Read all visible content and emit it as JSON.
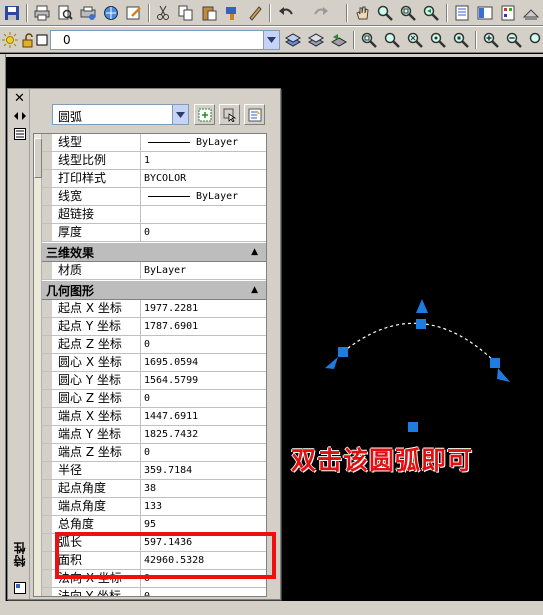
{
  "toolbar_top": {
    "icons": [
      "save-icon",
      "print-icon",
      "print-preview-icon",
      "plot-icon",
      "publish-icon",
      "edit-icon",
      "cut-icon",
      "copy-icon",
      "paste-icon",
      "match-properties-icon",
      "brush-icon",
      "undo-icon",
      "redo-icon",
      "pan-icon",
      "zoom-realtime-icon",
      "zoom-window-icon",
      "zoom-previous-icon",
      "properties-icon",
      "design-center-icon",
      "tool-palette-icon",
      "markup-icon"
    ]
  },
  "toolbar_layer": {
    "layer_name": "0",
    "icons": [
      "layer-on-icon",
      "layer-unlock-icon",
      "layer-color-icon",
      "layer-manager-icon",
      "layer-states-icon",
      "layer-previous-icon",
      "zoom-window2-icon",
      "zoom-dynamic-icon",
      "zoom-scale-icon",
      "zoom-center-icon",
      "zoom-object-icon",
      "zoom-in-icon",
      "zoom-out-icon",
      "zoom-all-icon"
    ]
  },
  "palette": {
    "title": "特性",
    "object_type": "圆弧",
    "rows_general": [
      {
        "name": "线型",
        "value": "ByLayer",
        "line": true
      },
      {
        "name": "线型比例",
        "value": "1",
        "line": false
      },
      {
        "name": "打印样式",
        "value": "BYCOLOR",
        "line": false
      },
      {
        "name": "线宽",
        "value": "ByLayer",
        "line": true
      },
      {
        "name": "超链接",
        "value": "",
        "line": false
      },
      {
        "name": "厚度",
        "value": "0",
        "line": false
      }
    ],
    "cat_3d": "三维效果",
    "rows_3d": [
      {
        "name": "材质",
        "value": "ByLayer",
        "line": false
      }
    ],
    "cat_geometry": "几何图形",
    "rows_geometry": [
      {
        "name": "起点 X 坐标",
        "value": "1977.2281"
      },
      {
        "name": "起点 Y 坐标",
        "value": "1787.6901"
      },
      {
        "name": "起点 Z 坐标",
        "value": "0"
      },
      {
        "name": "圆心 X 坐标",
        "value": "1695.0594"
      },
      {
        "name": "圆心 Y 坐标",
        "value": "1564.5799"
      },
      {
        "name": "圆心 Z 坐标",
        "value": "0"
      },
      {
        "name": "端点 X 坐标",
        "value": "1447.6911"
      },
      {
        "name": "端点 Y 坐标",
        "value": "1825.7432"
      },
      {
        "name": "端点 Z 坐标",
        "value": "0"
      },
      {
        "name": "半径",
        "value": "359.7184"
      },
      {
        "name": "起点角度",
        "value": "38"
      },
      {
        "name": "端点角度",
        "value": "133"
      },
      {
        "name": "总角度",
        "value": "95"
      },
      {
        "name": "弧长",
        "value": "597.1436"
      },
      {
        "name": "面积",
        "value": "42960.5328"
      },
      {
        "name": "法向 X 坐标",
        "value": "0"
      },
      {
        "name": "法向 Y 坐标",
        "value": "0"
      }
    ]
  },
  "canvas": {
    "instruction": "双击该圆弧即可",
    "grip_color": "#1e7be0",
    "arc_color": "#ffffff"
  },
  "highlight_color": "#f00f0f"
}
